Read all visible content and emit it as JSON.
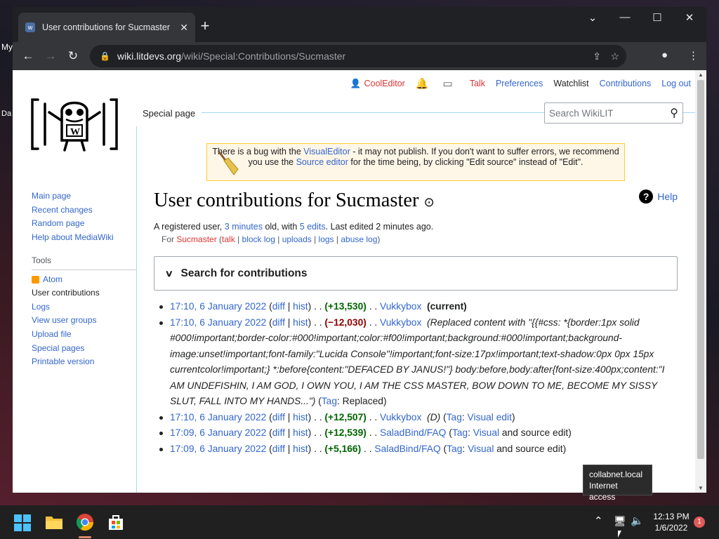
{
  "desktop": {
    "left_label": "My",
    "left_label2": "Da"
  },
  "browser": {
    "tab_title": "User contributions for Sucmaster",
    "url_host": "wiki.litdevs.org",
    "url_path": "/wiki/Special:Contributions/Sucmaster"
  },
  "usernav": {
    "username": "CoolEditor",
    "talk": "Talk",
    "preferences": "Preferences",
    "watchlist": "Watchlist",
    "contributions": "Contributions",
    "logout": "Log out"
  },
  "page_tab": "Special page",
  "search_placeholder": "Search WikiLIT",
  "sidebar": {
    "nav": [
      "Main page",
      "Recent changes",
      "Random page",
      "Help about MediaWiki"
    ],
    "tools_heading": "Tools",
    "tools": [
      "Atom",
      "User contributions",
      "Logs",
      "View user groups",
      "Upload file",
      "Special pages",
      "Printable version"
    ]
  },
  "notice": {
    "p1": "There is a bug with the ",
    "link1": "VisualEditor",
    "p2": " - it may not publish. If you don't want to suffer errors, we recommend you use the ",
    "link2": "Source editor",
    "p3": " for the time being, by clicking \"Edit source\" instead of \"Edit\"."
  },
  "title": "User contributions for Sucmaster",
  "help": "Help",
  "info": {
    "p1": "A registered user, ",
    "age": "3 minutes",
    "p2": " old, with ",
    "edits": "5 edits",
    "p3": ". Last edited 2 minutes ago."
  },
  "for_line": {
    "for": "For ",
    "user": "Sucmaster",
    "talk": "talk",
    "block": "block log",
    "uploads": "uploads",
    "logs": "logs",
    "abuse": "abuse log"
  },
  "search_contribs": "Search for contributions",
  "contribs": [
    {
      "time": "17:10, 6 January 2022",
      "diff": "diff",
      "hist": "hist",
      "size": "(+13,530)",
      "sign": "pos",
      "page": "Vukkybox",
      "extra": "(current)",
      "comment": "",
      "tag": "",
      "tag_rest": ""
    },
    {
      "time": "17:10, 6 January 2022",
      "diff": "diff",
      "hist": "hist",
      "size": "(−12,030)",
      "sign": "neg",
      "page": "Vukkybox",
      "extra": "",
      "comment": "(Replaced content with \"{{#css: *{border:1px solid #000!important;border-color:#000!important;color:#f00!important;background:#000!important;background-image:unset!important;font-family:\"Lucida Console\"!important;font-size:17px!important;text-shadow:0px 0px 15px currentcolor!important;} *:before{content:\"DEFACED BY JANUS!\"} body:before,body:after{font-size:400px;content:\"I AM UNDEFISHIN, I AM GOD, I OWN YOU, I AM THE CSS MASTER, BOW DOWN TO ME, BECOME MY SISSY SLUT, FALL INTO MY HANDS...\")",
      "tag": "Tag",
      "tag_rest": "Replaced)"
    },
    {
      "time": "17:10, 6 January 2022",
      "diff": "diff",
      "hist": "hist",
      "size": "(+12,507)",
      "sign": "pos",
      "page": "Vukkybox",
      "extra": "",
      "comment": "(D)",
      "tag": "Tag",
      "tag_rest": "Visual edit"
    },
    {
      "time": "17:09, 6 January 2022",
      "diff": "diff",
      "hist": "hist",
      "size": "(+12,539)",
      "sign": "pos",
      "page": "SaladBind/FAQ",
      "extra": "",
      "comment": "",
      "tag": "Tag",
      "tag_rest": "Visual"
    },
    {
      "time": "17:09, 6 January 2022",
      "diff": "diff",
      "hist": "hist",
      "size": "(+5,166)",
      "sign": "pos",
      "page": "SaladBind/FAQ",
      "extra": "",
      "comment": "",
      "tag": "Tag",
      "tag_rest": "Visual"
    }
  ],
  "contrib_suffix": " and source edit)",
  "tooltip": {
    "line1": "collabnet.local",
    "line2": "Internet access"
  },
  "clock": {
    "time": "12:13 PM",
    "date": "1/6/2022"
  },
  "notif_count": "1"
}
